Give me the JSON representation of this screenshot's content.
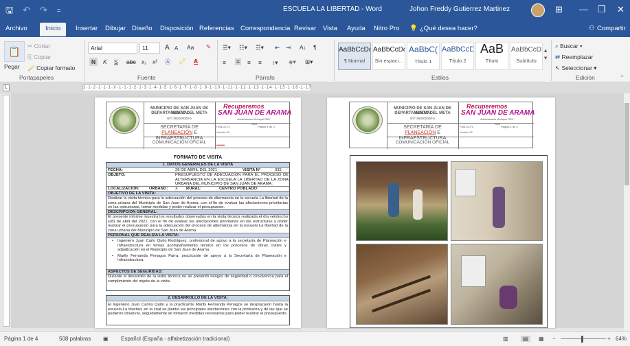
{
  "window": {
    "title": "ESCUELA LA LIBERTAD - Word",
    "user": "Johon Freddy Gutierrez Martinez",
    "quick_access": [
      "save-icon",
      "undo-icon",
      "redo-icon",
      "customize-icon"
    ],
    "controls": {
      "ribbon_display": "⊞",
      "minimize": "—",
      "restore": "❐",
      "close": "✕"
    }
  },
  "menu": {
    "tabs": [
      "Archivo",
      "Inicio",
      "Insertar",
      "Dibujar",
      "Diseño",
      "Disposición",
      "Referencias",
      "Correspondencia",
      "Revisar",
      "Vista",
      "Ayuda",
      "Nitro Pro"
    ],
    "active": "Inicio",
    "tell_me": "¿Qué desea hacer?",
    "share": "Compartir"
  },
  "ribbon": {
    "clipboard": {
      "paste": "Pegar",
      "cut": "Cortar",
      "copy": "Copiar",
      "format_painter": "Copiar formato",
      "label": "Portapapeles"
    },
    "font": {
      "name": "Arial",
      "size": "11",
      "grow": "A",
      "shrink": "A",
      "case": "Aa",
      "bold": "N",
      "italic": "K",
      "underline": "S",
      "strike": "abc",
      "sub": "x₂",
      "sup": "x²",
      "label": "Fuente"
    },
    "paragraph": {
      "label": "Párrafo"
    },
    "styles": {
      "items": [
        {
          "sample": "AaBbCcDc",
          "name": "¶ Normal"
        },
        {
          "sample": "AaBbCcDc",
          "name": "Sin espaci..."
        },
        {
          "sample": "AaBbC(",
          "name": "Título 1"
        },
        {
          "sample": "AaBbCcD",
          "name": "Título 2"
        },
        {
          "sample": "AaB",
          "name": "Título"
        },
        {
          "sample": "AaBbCcD",
          "name": "Subtítulo"
        }
      ],
      "label": "Estilos"
    },
    "editing": {
      "find": "Buscar",
      "replace": "Reemplazar",
      "select": "Seleccionar",
      "label": "Edición"
    }
  },
  "ruler": {
    "scale": "3·1·2·1·1·1·X·1·1·1·2·1·3·1·4·1·5·1·6·1·7·1·8·1·9·1·10·1·11·1·12·1·13·1·14·1·15·1·16·1·17·1·18"
  },
  "document": {
    "header": {
      "muni": "MUNICIPIO DE SAN JUAN DE ARAMA",
      "dept": "DEPARTAMENTO DEL META",
      "nit": "NIT: 892000000-5",
      "logo_line1": "Recuperemos",
      "logo_line2": "SAN JUAN DE ARAMA",
      "logo_sub": "Administración Municipal 2020 - 2023",
      "secretaria_pre": "SECRETARÍA DE",
      "secretaria_word": "PLANEACIÓN",
      "secretaria_post": "E INFRAESTRUCTURA",
      "comunicacion": "COMUNICACIÓN OFICIAL",
      "code": "FDN-01-F1",
      "page_ref": "Página 1 de 4",
      "version": "Versión 02"
    },
    "form_title": "FORMATO DE VISITA",
    "sec1": "1.  DATOS GENERALES DE LA VISITA",
    "fecha_label": "FECHA:",
    "fecha": "28 DE ABRIL DEL 2021",
    "visita_label": "VISITA N°",
    "visita_num": "035",
    "objeto_label": "OBJETO:",
    "objeto": "PRESUPUESTO DE ADECUACIÓN PARA EL PROCESO DE ALTERNANCIA EN LA ESCUELA LA LIBERTAD DE LA ZONA URBANA DEL MUNICIPIO DE SAN JUAN DE ARAMA.",
    "loc_label": "LOCALIZACIÓN:",
    "urbano": "URBANO:",
    "x": "X",
    "rural": "RURAL:",
    "centro": "CENTRO POBLADO:",
    "obj_visita_label": "OBJETIVO DE LA VISITA:",
    "obj_visita": "Realizar la visita técnica para la adecuación del proceso de alternancia en la escuela La libertad de la zona urbana del Municipio de San Juan de Arama, con el fin de evaluar las afectaciones prioritarias en las estructuras, tomar medidas y poder realizar el presupuesto.",
    "desc_label": "DESCRIPCIÓN GENERAL:",
    "desc": "El presente informe muestra los resultados observados en la visita técnica realizada el día veintiocho (28) de abril del 2021, con el fin de evaluar las afectaciones prioritarias en las estructuras y poder realizar el presupuesto para la adecuación del proceso de alternancia en la escuela La libertad de la zona urbana del Municipio de San Juan de Arama.",
    "personal_label": "PERSONAL QUE REALIZA LA VISITA:",
    "personal": [
      "Ingeniero Juan Carlo Quito Rodríguez, profesional de apoyo a la secretaría de Planeación e Infraestructura en temas acompañamiento técnico en los procesos de obras civiles y adjudicación en el Municipio de San Juan de Arama",
      "Marlly Fernanda Penagos Parra, practicante de apoyo a la Secretaría de Planeación e Infraestructura."
    ],
    "seguridad_label": "ASPECTOS DE SEGURIDAD:",
    "seguridad": "Durante el desarrollo de la visita técnica no se presentó riesgos de seguridad o convivencia para el cumplimiento del objeto de la visita.",
    "sec2": "2.  DESARROLLO DE LA VISITA:",
    "desarrollo": "El ingeniero Juan Carlos Quito y la practicante Marlly Fernanda Penagos se desplazaron hasta la escuela La libertad, en la cual se plantel las principales afectaciones con la profesora y de las que se pudieron observar, seguidamente se tomaron medidas necesarias para poder realizar el presupuesto."
  },
  "status": {
    "page": "Página 1 de 4",
    "words": "508 palabras",
    "lang": "Español (España - alfabetización tradicional)",
    "zoom": "64%"
  }
}
